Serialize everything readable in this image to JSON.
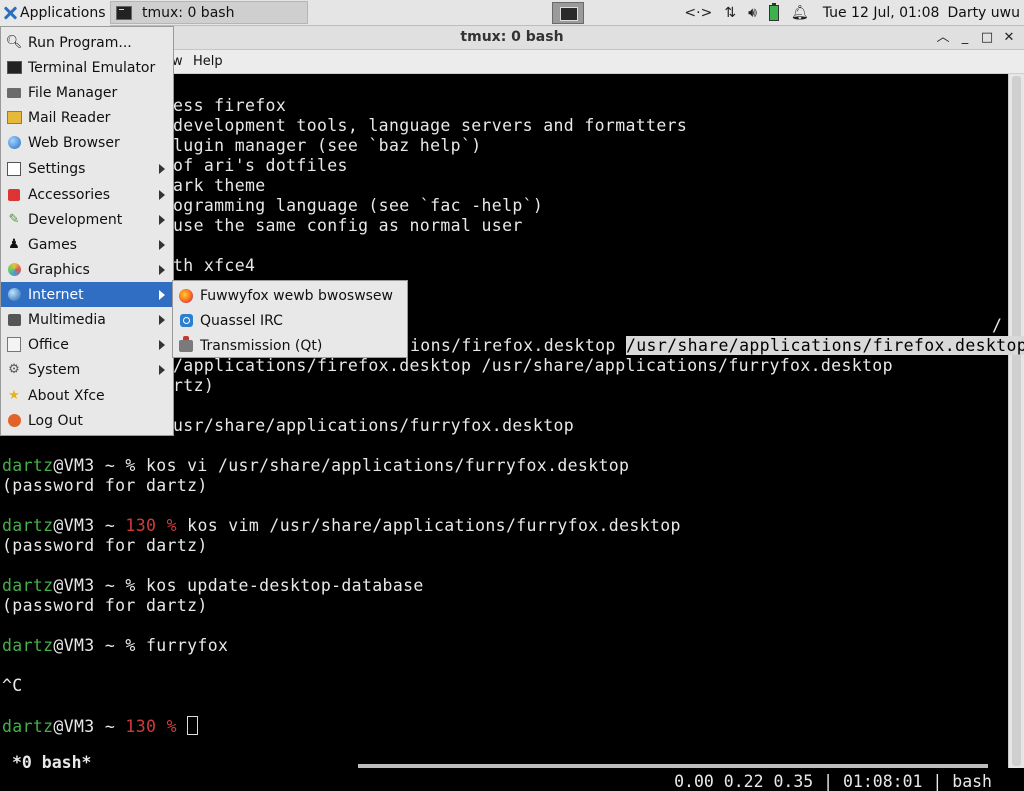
{
  "panel": {
    "apps_label": "Applications",
    "task_label": "tmux: 0 bash",
    "clock": "Tue 12 Jul, 01:08",
    "user": "Darty uwu"
  },
  "window": {
    "title": "tmux: 0 bash",
    "menu": {
      "view_partial": "w",
      "help": "Help"
    }
  },
  "app_menu": {
    "items": [
      {
        "label": "Run Program...",
        "icon": "search-icon"
      },
      {
        "label": "Terminal Emulator",
        "icon": "terminal-icon"
      },
      {
        "label": "File Manager",
        "icon": "folder-icon"
      },
      {
        "label": "Mail Reader",
        "icon": "mail-icon"
      },
      {
        "label": "Web Browser",
        "icon": "globe-icon"
      },
      {
        "label": "Settings",
        "icon": "settings-icon"
      },
      {
        "label": "Accessories",
        "icon": "accessories-icon"
      },
      {
        "label": "Development",
        "icon": "development-icon"
      },
      {
        "label": "Games",
        "icon": "games-icon"
      },
      {
        "label": "Graphics",
        "icon": "graphics-icon"
      },
      {
        "label": "Internet",
        "icon": "internet-icon"
      },
      {
        "label": "Multimedia",
        "icon": "multimedia-icon"
      },
      {
        "label": "Office",
        "icon": "office-icon"
      },
      {
        "label": "System",
        "icon": "system-icon"
      },
      {
        "label": "About Xfce",
        "icon": "star-icon"
      },
      {
        "label": "Log Out",
        "icon": "logout-icon"
      }
    ]
  },
  "internet_submenu": {
    "items": [
      {
        "label": "Fuwwyfox wewb bwoswsew",
        "icon": "firefox-icon"
      },
      {
        "label": "Quassel IRC",
        "icon": "quassel-icon"
      },
      {
        "label": "Transmission (Qt)",
        "icon": "transmission-icon"
      }
    ]
  },
  "terminal": {
    "lines": {
      "l1": "ess firefox",
      "l2": "development tools, language servers and formatters",
      "l3": "lugin manager (see `baz help`)",
      "l4": "of ari's dotfiles",
      "l5": "ark theme",
      "l6": "ogramming language (see `fac -help`)",
      "l7": "use the same config as normal user",
      "l8": "th xfce4",
      "l9": "/",
      "l10a": "ions/firefox.desktop ",
      "l10b": "/usr/share/applications/firefox.desktop",
      "l11": "/applications/firefox.desktop /usr/share/applications/furryfox.desktop",
      "l12": "rtz)",
      "l13": "usr/share/applications/furryfox.desktop"
    },
    "prompt_user": "dartz",
    "prompt_host": "@VM3 ~ ",
    "prompt_code": "130",
    "prompt_symbol": "%",
    "cmd1": " kos vi /usr/share/applications/furryfox.desktop",
    "pw1": "(password for dartz)",
    "cmd2": " kos vim /usr/share/applications/furryfox.desktop",
    "pw2": "(password for dartz)",
    "cmd3": " kos update-desktop-database",
    "pw3": "(password for dartz)",
    "cmd4": " furryfox",
    "interrupt": "^C",
    "status_left": "*0 bash*",
    "status_right": "0.00 0.22 0.35 | 01:08:01 | bash"
  }
}
